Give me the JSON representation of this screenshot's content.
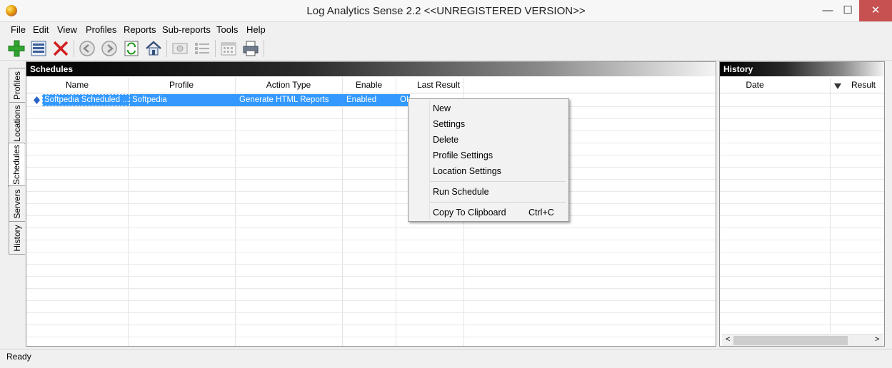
{
  "window": {
    "title": "Log Analytics Sense 2.2 <<UNREGISTERED VERSION>>",
    "app_icon": "app-logo-icon",
    "controls": {
      "minimize": "—",
      "maximize": "☐",
      "close": "✕"
    }
  },
  "menu": [
    "File",
    "Edit",
    "View",
    "Profiles",
    "Reports",
    "Sub-reports",
    "Tools",
    "Help"
  ],
  "toolbar": [
    {
      "name": "add-icon"
    },
    {
      "name": "properties-icon"
    },
    {
      "name": "delete-icon"
    },
    {
      "name": "back-icon"
    },
    {
      "name": "forward-icon"
    },
    {
      "name": "refresh-icon"
    },
    {
      "name": "home-icon"
    },
    {
      "name": "preview-icon"
    },
    {
      "name": "list-icon"
    },
    {
      "name": "calendar-icon"
    },
    {
      "name": "print-icon"
    }
  ],
  "side_tabs": [
    "Profiles",
    "Locations",
    "Schedules",
    "Servers",
    "History"
  ],
  "active_tab": "Schedules",
  "schedules": {
    "title": "Schedules",
    "columns": [
      "Name",
      "Profile",
      "Action Type",
      "Enable",
      "Last Result"
    ],
    "rows": [
      {
        "name": "Softpedia Scheduled ...",
        "profile": "Softpedia",
        "action_type": "Generate HTML Reports",
        "enable": "Enabled",
        "last_result": "OK"
      }
    ]
  },
  "history": {
    "title": "History",
    "columns": [
      "Date",
      "Result"
    ],
    "sort_icon": "sort-desc-icon"
  },
  "context_menu": {
    "items": [
      {
        "label": "New",
        "shortcut": ""
      },
      {
        "label": "Settings",
        "shortcut": ""
      },
      {
        "label": "Delete",
        "shortcut": ""
      },
      {
        "label": "Profile Settings",
        "shortcut": ""
      },
      {
        "label": "Location Settings",
        "shortcut": ""
      },
      {
        "label": "Run Schedule",
        "shortcut": ""
      },
      {
        "label": "Copy To Clipboard",
        "shortcut": "Ctrl+C"
      }
    ]
  },
  "status": {
    "text": "Ready"
  },
  "scrollbar": {
    "left_arrow": "<",
    "right_arrow": ">"
  },
  "colors": {
    "selection": "#3399ff",
    "close_button": "#c75050"
  }
}
